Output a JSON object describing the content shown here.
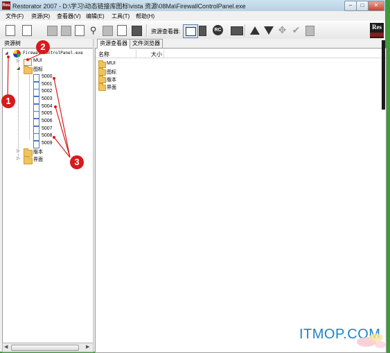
{
  "window": {
    "title": "Restorator 2007 - D:\\学习\\动态链接库图标\\vista 资源\\08Ma\\FirewallControlPanel.exe",
    "app_icon_text": "Res"
  },
  "window_controls": {
    "minimize": "–",
    "maximize": "□",
    "close": "✕"
  },
  "menu": [
    {
      "label": "文件(F)"
    },
    {
      "label": "资源(R)"
    },
    {
      "label": "查看器(V)"
    },
    {
      "label": "编辑(E)"
    },
    {
      "label": "工具(T)"
    },
    {
      "label": "帮助(H)"
    }
  ],
  "toolbar": {
    "viewer_label": "资源查看器:",
    "rc_button": "RC",
    "logo_text": "Res",
    "icons": [
      "new-file-icon",
      "open-file-icon",
      "save-icon",
      "extract-icon",
      "grab-icon",
      "search-icon",
      "paste-icon",
      "copy-icon",
      "book-icon",
      "viewer-icon",
      "split-icon",
      "rc-icon",
      "binary-icon",
      "move-up-icon",
      "move-down-icon",
      "navigate-icon",
      "apply-icon",
      "document-icon"
    ]
  },
  "left_panel": {
    "header": "资源树"
  },
  "tree": {
    "root": "FirewallControlPanel.exe",
    "mui": "MUI",
    "icons_folder": "图标",
    "items": [
      "5000",
      "5001",
      "5002",
      "5003",
      "5004",
      "5005",
      "5006",
      "5007",
      "5008",
      "5009"
    ],
    "version": "版本",
    "ui": "界面"
  },
  "tabs": [
    {
      "label": "资源查看器"
    },
    {
      "label": "文件浏览器"
    }
  ],
  "list": {
    "columns": [
      "名称",
      "大小"
    ],
    "rows": [
      {
        "name": "MUI"
      },
      {
        "name": "图标"
      },
      {
        "name": "版本"
      },
      {
        "name": "界面"
      }
    ]
  },
  "annotations": {
    "badge1": "1",
    "badge2": "2",
    "badge3": "3",
    "color": "#d71a1a"
  },
  "watermark": "ITMOP.COM"
}
